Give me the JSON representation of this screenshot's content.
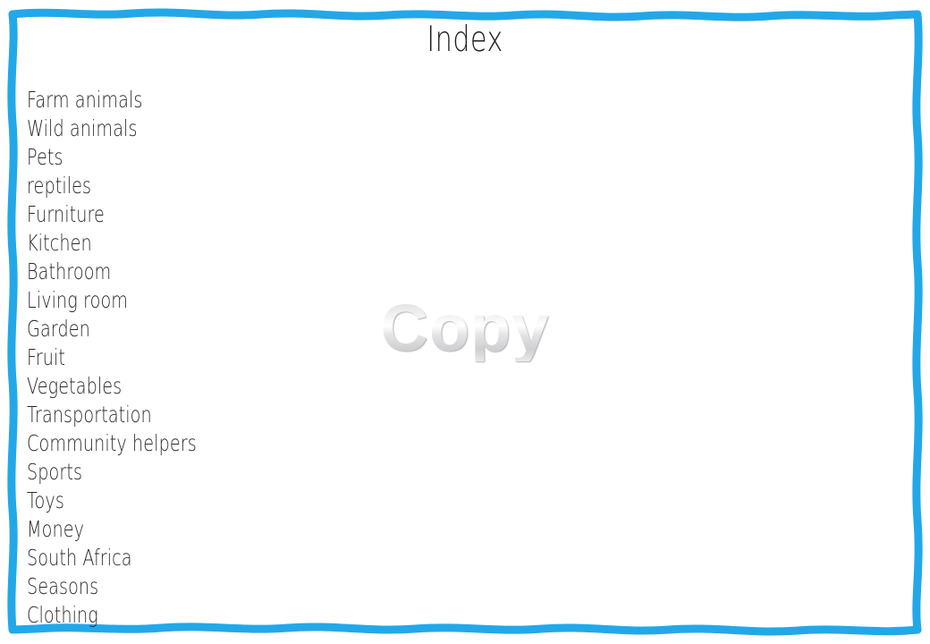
{
  "page": {
    "title": "Index",
    "background_color": "#ffffff",
    "text_color": "#2b2b2b"
  },
  "border": {
    "style": "hand-drawn-wavy",
    "color": "#22a8e8",
    "thickness_px": 9
  },
  "index": {
    "items": [
      {
        "label": "Farm animals"
      },
      {
        "label": "Wild animals"
      },
      {
        "label": "Pets"
      },
      {
        "label": "reptiles"
      },
      {
        "label": "Furniture"
      },
      {
        "label": "Kitchen"
      },
      {
        "label": "Bathroom"
      },
      {
        "label": "Living room"
      },
      {
        "label": "Garden"
      },
      {
        "label": "Fruit"
      },
      {
        "label": "Vegetables"
      },
      {
        "label": "Transportation"
      },
      {
        "label": "Community helpers"
      },
      {
        "label": "Sports"
      },
      {
        "label": "Toys"
      },
      {
        "label": "Money"
      },
      {
        "label": "South Africa"
      },
      {
        "label": "Seasons"
      },
      {
        "label": "Clothing"
      }
    ]
  },
  "watermark": {
    "text": "Copy",
    "color": "#d5d5d8"
  }
}
